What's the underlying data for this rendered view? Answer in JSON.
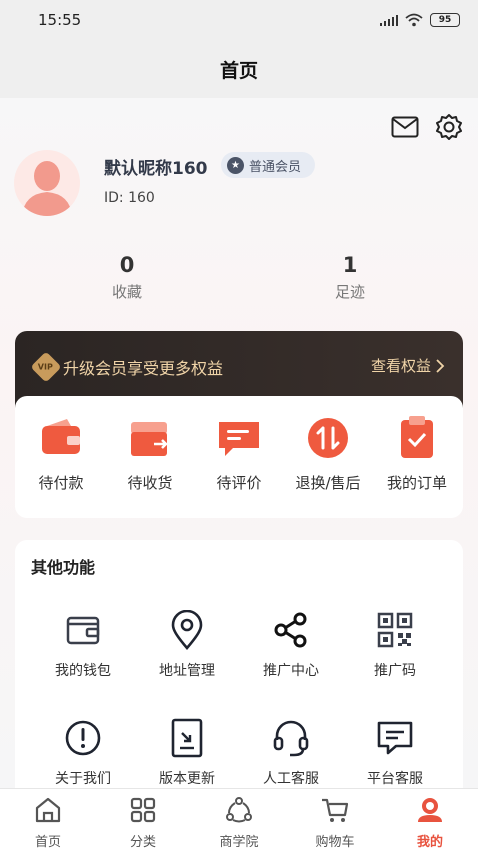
{
  "status_bar": {
    "time": "15:55",
    "battery": "95"
  },
  "header": {
    "title": "首页"
  },
  "profile": {
    "nickname": "默认昵称160",
    "member_level": "普通会员",
    "user_id": "ID: 160",
    "stats": [
      {
        "value": "0",
        "label": "收藏"
      },
      {
        "value": "1",
        "label": "足迹"
      }
    ]
  },
  "vip_banner": {
    "text": "升级会员享受更多权益",
    "link": "查看权益",
    "badge": "VIP"
  },
  "orders": [
    {
      "label": "待付款",
      "icon": "wallet-icon"
    },
    {
      "label": "待收货",
      "icon": "receive-box-icon"
    },
    {
      "label": "待评价",
      "icon": "comment-icon"
    },
    {
      "label": "退换/售后",
      "icon": "exchange-icon"
    },
    {
      "label": "我的订单",
      "icon": "clipboard-icon"
    }
  ],
  "other_functions": {
    "title": "其他功能",
    "items": [
      {
        "label": "我的钱包",
        "icon": "wallet-outline-icon"
      },
      {
        "label": "地址管理",
        "icon": "location-pin-icon"
      },
      {
        "label": "推广中心",
        "icon": "share-nodes-icon"
      },
      {
        "label": "推广码",
        "icon": "qr-code-icon"
      },
      {
        "label": "关于我们",
        "icon": "info-circle-icon"
      },
      {
        "label": "版本更新",
        "icon": "update-document-icon"
      },
      {
        "label": "人工客服",
        "icon": "headset-icon"
      },
      {
        "label": "平台客服",
        "icon": "chat-bubble-icon"
      }
    ]
  },
  "tabs": [
    {
      "label": "首页",
      "icon": "home-icon"
    },
    {
      "label": "分类",
      "icon": "grid-icon"
    },
    {
      "label": "商学院",
      "icon": "academy-icon"
    },
    {
      "label": "购物车",
      "icon": "cart-icon"
    },
    {
      "label": "我的",
      "icon": "profile-icon",
      "active": true
    }
  ],
  "colors": {
    "accent": "#e8533f",
    "vip_gold": "#f0d4a8",
    "vip_bg": "#2b2523"
  }
}
